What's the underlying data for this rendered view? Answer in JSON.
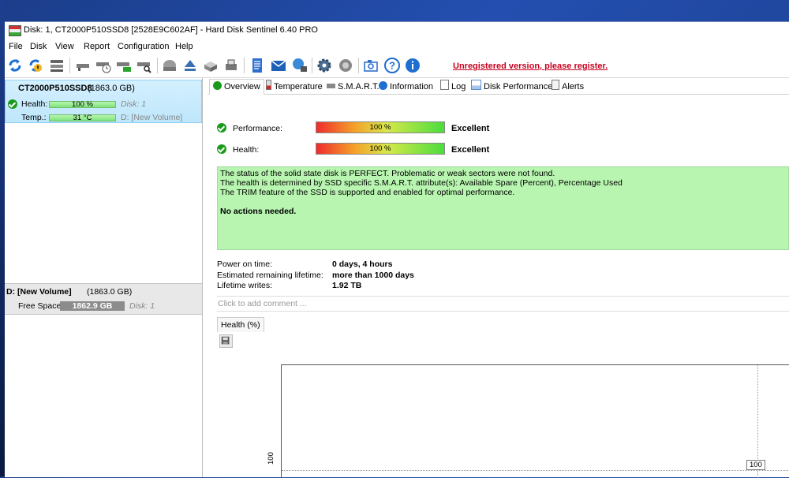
{
  "window": {
    "title": "Disk: 1, CT2000P510SSD8 [2528E9C602AF]  -  Hard Disk Sentinel 6.40 PRO"
  },
  "menu": [
    "File",
    "Disk",
    "View",
    "Report",
    "Configuration",
    "Help"
  ],
  "toolbar": {
    "icons": [
      "refresh-icon",
      "refresh-warning-icon",
      "disk-list-icon",
      "disk-status-icon",
      "disk-timer-icon",
      "disk-check-icon",
      "disk-search-icon",
      "hdd-gray-icon",
      "eject-icon",
      "drive-3d-icon",
      "drive-print-icon",
      "report-icon",
      "mail-icon",
      "network-icon",
      "settings-gear-icon",
      "sound-icon",
      "screenshot-camera-icon",
      "help-icon",
      "info-icon"
    ],
    "unregistered_text": "Unregistered version, please register."
  },
  "left": {
    "disk": {
      "name": "CT2000P510SSD8",
      "size": "(1863.0 GB)",
      "health_label": "Health:",
      "health_value": "100 %",
      "health_disk": "Disk: 1",
      "temp_label": "Temp.:",
      "temp_value": "31 °C",
      "temp_volume": "D: [New Volume]"
    },
    "volume": {
      "name": "D: [New Volume]",
      "size": "(1863.0 GB)",
      "free_label": "Free Space",
      "free_value": "1862.9 GB",
      "disk": "Disk: 1"
    }
  },
  "tabs": [
    {
      "label": "Overview",
      "icon": "check-icon"
    },
    {
      "label": "Temperature",
      "icon": "thermometer-icon"
    },
    {
      "label": "S.M.A.R.T.",
      "icon": "smart-icon"
    },
    {
      "label": "Information",
      "icon": "info-icon"
    },
    {
      "label": "Log",
      "icon": "log-icon"
    },
    {
      "label": "Disk Performance",
      "icon": "chart-icon"
    },
    {
      "label": "Alerts",
      "icon": "alert-icon"
    }
  ],
  "overview": {
    "performance_label": "Performance:",
    "performance_value": "100 %",
    "performance_verdict": "Excellent",
    "performance_level": 100,
    "health_label": "Health:",
    "health_value": "100 %",
    "health_verdict": "Excellent",
    "health_level": 100,
    "status_lines": [
      "The status of the solid state disk is PERFECT. Problematic or weak sectors were not found.",
      "The health is determined by SSD specific S.M.A.R.T. attribute(s):  Available Spare (Percent), Percentage Used",
      "The TRIM feature of the SSD is supported and enabled for optimal performance."
    ],
    "status_action": "No actions needed.",
    "power_on_label": "Power on time:",
    "power_on_value": "0 days, 4 hours",
    "remaining_label": "Estimated remaining lifetime:",
    "remaining_value": "more than 1000 days",
    "writes_label": "Lifetime writes:",
    "writes_value": "1.92 TB",
    "comment_placeholder": "Click to add comment ..."
  },
  "health_chart": {
    "tab_label": "Health (%)",
    "y_tick": "100",
    "point_label": "100"
  },
  "chart_data": {
    "type": "line",
    "series": [
      {
        "values": [
          100
        ]
      }
    ],
    "y_ticks": [
      "100"
    ],
    "annotations": [
      "100"
    ]
  }
}
